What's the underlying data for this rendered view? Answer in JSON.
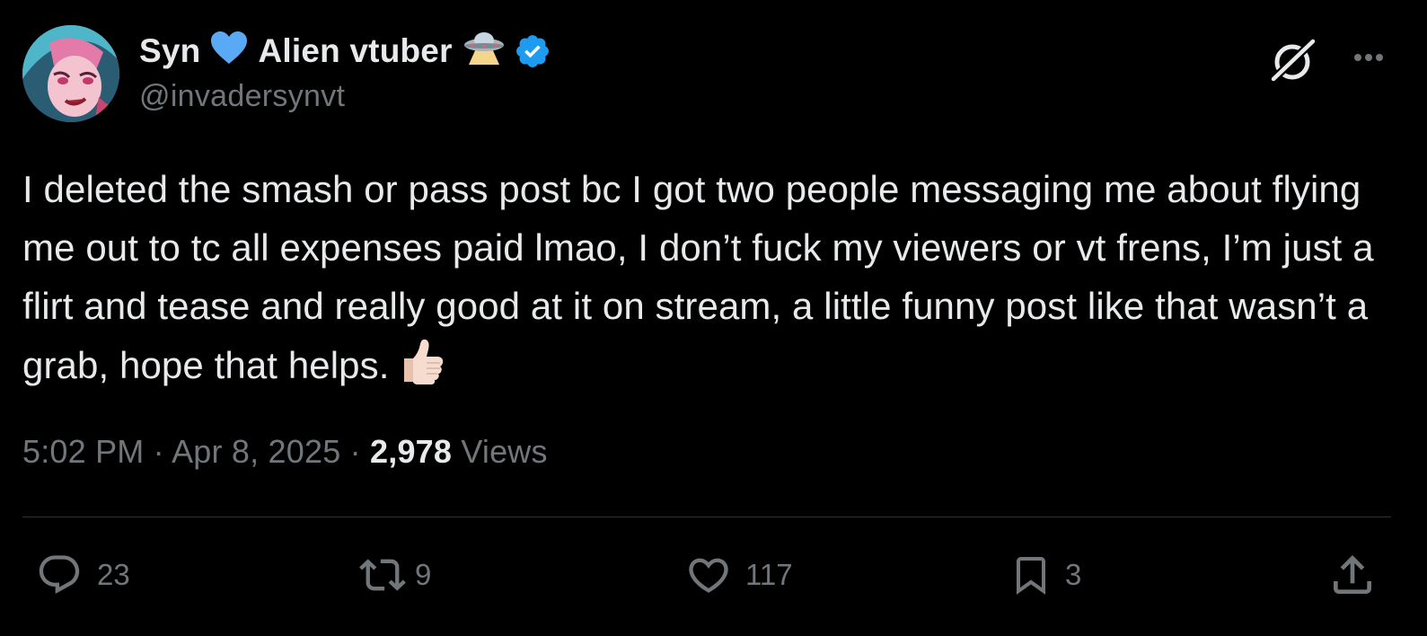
{
  "post": {
    "author": {
      "display_name_part1": "Syn",
      "display_name_emoji1": "💙",
      "display_name_part2": "Alien vtuber",
      "display_name_emoji2": "🛸",
      "handle": "@invadersynvt",
      "verified": true,
      "avatar_icon": "avatar-image"
    },
    "text": "I deleted the smash or pass post bc I got two people messaging me about flying me out to tc all expenses paid lmao, I don’t fuck my viewers or vt frens, I’m just a flirt and tease and really good at it on stream, a little funny post like that wasn’t a grab, hope that helps.",
    "text_emoji": "👍🏻",
    "meta": {
      "time": "5:02 PM",
      "separator": " · ",
      "date": "Apr 8, 2025",
      "views_count": "2,978",
      "views_label": "Views"
    },
    "actions": {
      "reply_count": "23",
      "repost_count": "9",
      "like_count": "117",
      "bookmark_count": "3"
    }
  },
  "icons": {
    "grok": "grok-icon",
    "more": "more-options-icon",
    "reply": "reply-icon",
    "repost": "repost-icon",
    "like": "heart-icon",
    "bookmark": "bookmark-icon",
    "share": "share-icon",
    "verified": "verified-badge-icon"
  },
  "colors": {
    "background": "#000000",
    "text_primary": "#e7e9ea",
    "text_secondary": "#71767b",
    "divider": "#2f3336",
    "verified_blue": "#1d9bf0",
    "heart_emoji": "#5aa9f5"
  }
}
